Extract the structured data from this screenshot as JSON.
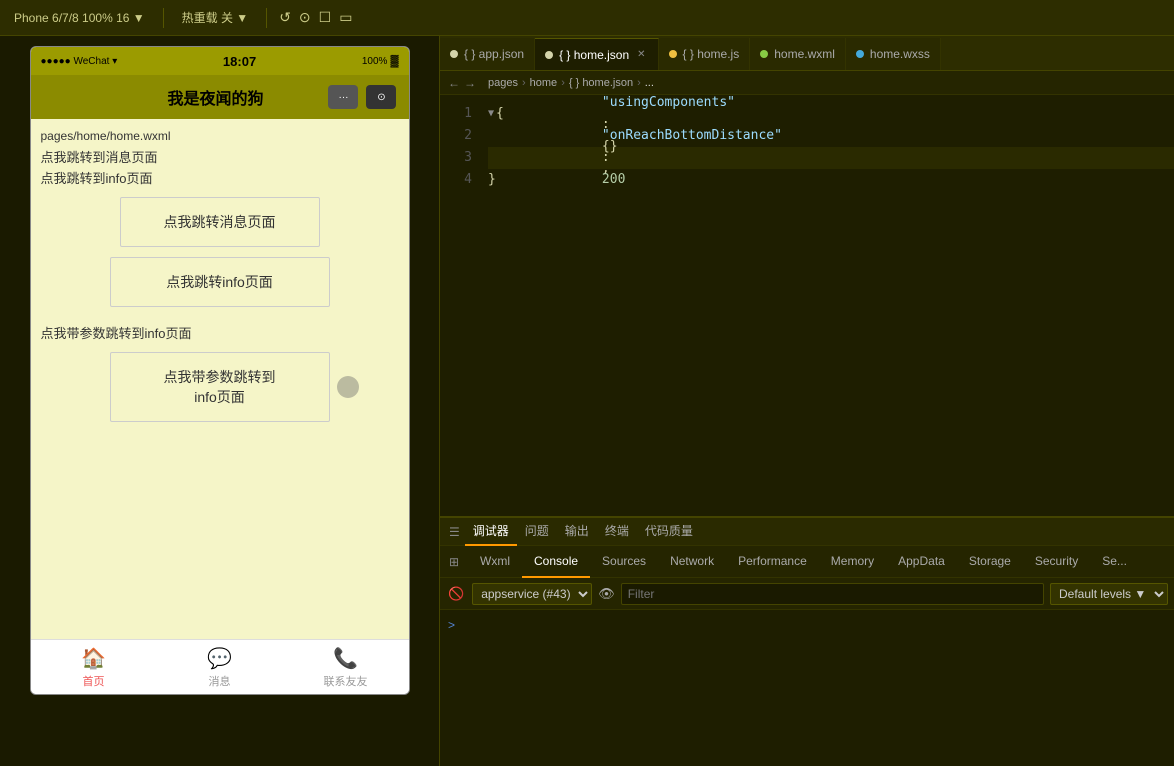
{
  "toolbar": {
    "device_label": "Phone 6/7/8 100% 16 ▼",
    "hot_reload_label": "热重载 关 ▼",
    "refresh_icon": "↺",
    "stop_icon": "⊙",
    "window_icon": "☐",
    "panel_icon": "▭"
  },
  "editor": {
    "tabs": [
      {
        "id": "app-json",
        "dot_color": "#d4d4aa",
        "label": "app.json",
        "active": false,
        "closable": false
      },
      {
        "id": "home-json",
        "dot_color": "#d4d4aa",
        "label": "home.json",
        "active": true,
        "closable": true
      },
      {
        "id": "home-js",
        "dot_color": "#f0c040",
        "label": "home.js",
        "active": false,
        "closable": false
      },
      {
        "id": "home-wxml",
        "dot_color": "#88cc44",
        "label": "home.wxml",
        "active": false,
        "closable": false
      },
      {
        "id": "home-wxss",
        "dot_color": "#44aadd",
        "label": "home.wxss",
        "active": false,
        "closable": false
      }
    ],
    "breadcrumb": {
      "back": "←",
      "forward": "→",
      "items": [
        "pages",
        "home",
        "{} home.json",
        "..."
      ]
    },
    "code_lines": [
      {
        "num": 1,
        "content": "{",
        "type": "brace_open",
        "fold": true,
        "highlighted": false
      },
      {
        "num": 2,
        "content": "    \"usingComponents\": {},",
        "type": "key_empty",
        "highlighted": false
      },
      {
        "num": 3,
        "content": "    \"onReachBottomDistance\": 200",
        "type": "key_num",
        "highlighted": true
      },
      {
        "num": 4,
        "content": "}",
        "type": "brace_close",
        "highlighted": false
      }
    ]
  },
  "phone": {
    "status_bar": {
      "left": "●●●●● WeChat ▾",
      "center": "18:07",
      "right": "100%"
    },
    "nav_title": "我是夜闻的狗",
    "content": {
      "path": "pages/home/home.wxml",
      "text1": "点我跳转到消息页面",
      "text2": "点我跳转到info页面",
      "btn1": "点我跳转消息页面",
      "btn2": "点我跳转info页面",
      "text3": "点我带参数跳转到info页面",
      "btn3": "点我带参数跳转到\ninfo页面"
    },
    "bottom_tabs": [
      {
        "id": "home",
        "icon": "🏠",
        "label": "首页",
        "active": true
      },
      {
        "id": "msg",
        "icon": "💬",
        "label": "消息",
        "active": false
      },
      {
        "id": "contact",
        "icon": "📞",
        "label": "联系友友",
        "active": false
      }
    ]
  },
  "devtools": {
    "top_tabs": [
      {
        "id": "debugger",
        "label": "调试器",
        "active": true
      },
      {
        "id": "issues",
        "label": "问题",
        "active": false
      },
      {
        "id": "output",
        "label": "输出",
        "active": false
      },
      {
        "id": "terminal",
        "label": "终端",
        "active": false
      },
      {
        "id": "code-quality",
        "label": "代码质量",
        "active": false
      }
    ],
    "second_tabs": [
      {
        "id": "wxml",
        "label": "Wxml",
        "active": false
      },
      {
        "id": "console",
        "label": "Console",
        "active": true
      },
      {
        "id": "sources",
        "label": "Sources",
        "active": false
      },
      {
        "id": "network",
        "label": "Network",
        "active": false
      },
      {
        "id": "performance",
        "label": "Performance",
        "active": false
      },
      {
        "id": "memory",
        "label": "Memory",
        "active": false
      },
      {
        "id": "appdata",
        "label": "AppData",
        "active": false
      },
      {
        "id": "storage",
        "label": "Storage",
        "active": false
      },
      {
        "id": "security",
        "label": "Security",
        "active": false
      },
      {
        "id": "more",
        "label": "Se...",
        "active": false
      }
    ],
    "toolbar": {
      "clear_icon": "🚫",
      "context_select": "appservice (#43)",
      "context_arrow": "▼",
      "eye_icon": "👁",
      "filter_placeholder": "Filter",
      "levels_label": "Default levels ▼"
    },
    "console_content": {
      "prompt_arrow": ">"
    }
  }
}
